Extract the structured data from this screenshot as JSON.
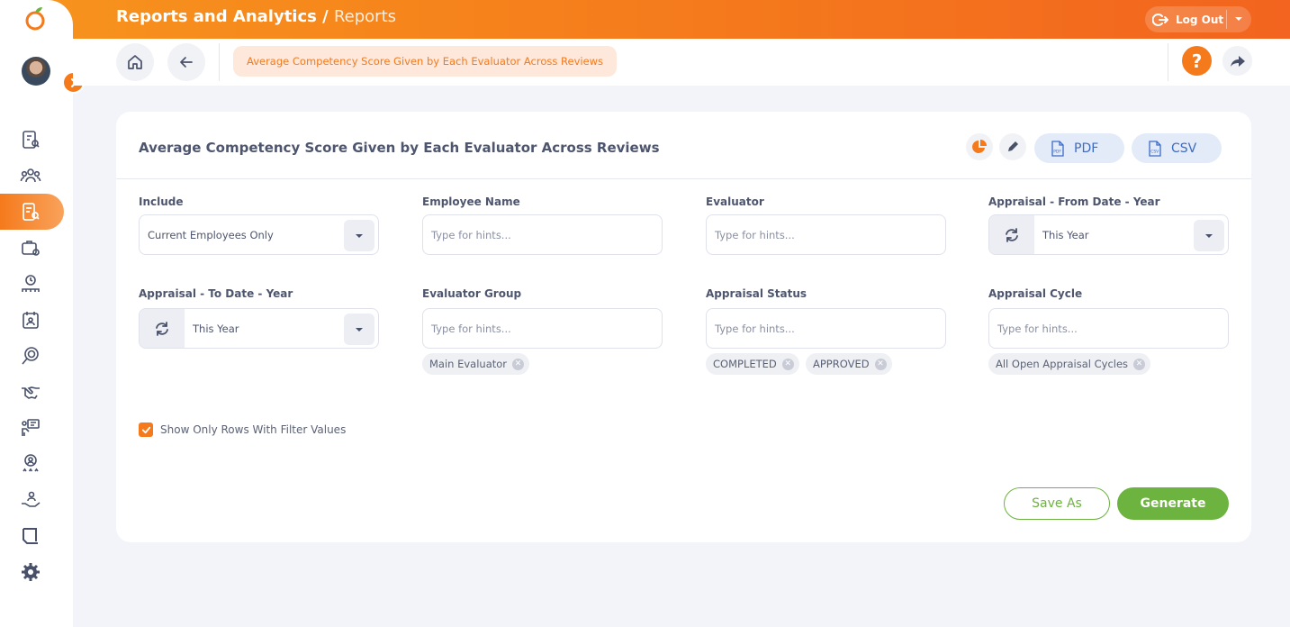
{
  "header": {
    "title": "Reports and Analytics /",
    "subtitle": "Reports",
    "logout_label": "Log Out"
  },
  "breadcrumb": {
    "current": "Average Competency Score Given by Each Evaluator Across Reviews"
  },
  "help_label": "?",
  "report": {
    "title": "Average Competency Score Given by Each Evaluator Across Reviews",
    "pdf_label": "PDF",
    "csv_label": "CSV"
  },
  "filters": {
    "include": {
      "label": "Include",
      "value": "Current Employees Only"
    },
    "employee_name": {
      "label": "Employee Name",
      "placeholder": "Type for hints..."
    },
    "evaluator": {
      "label": "Evaluator",
      "placeholder": "Type for hints..."
    },
    "from_year": {
      "label": "Appraisal - From Date - Year",
      "value": "This Year"
    },
    "to_year": {
      "label": "Appraisal - To Date - Year",
      "value": "This Year"
    },
    "evaluator_group": {
      "label": "Evaluator Group",
      "placeholder": "Type for hints...",
      "chips": [
        "Main Evaluator"
      ]
    },
    "appraisal_status": {
      "label": "Appraisal Status",
      "placeholder": "Type for hints...",
      "chips": [
        "COMPLETED",
        "APPROVED"
      ]
    },
    "appraisal_cycle": {
      "label": "Appraisal Cycle",
      "placeholder": "Type for hints...",
      "chips": [
        "All Open Appraisal Cycles"
      ]
    }
  },
  "options": {
    "show_only_rows_label": "Show Only Rows With Filter Values",
    "show_only_rows_checked": true
  },
  "actions": {
    "save_as": "Save As",
    "generate": "Generate"
  },
  "colors": {
    "brand_orange": "#f57a1c",
    "accent_green": "#6db33f",
    "export_blue": "#3d6cc4"
  }
}
